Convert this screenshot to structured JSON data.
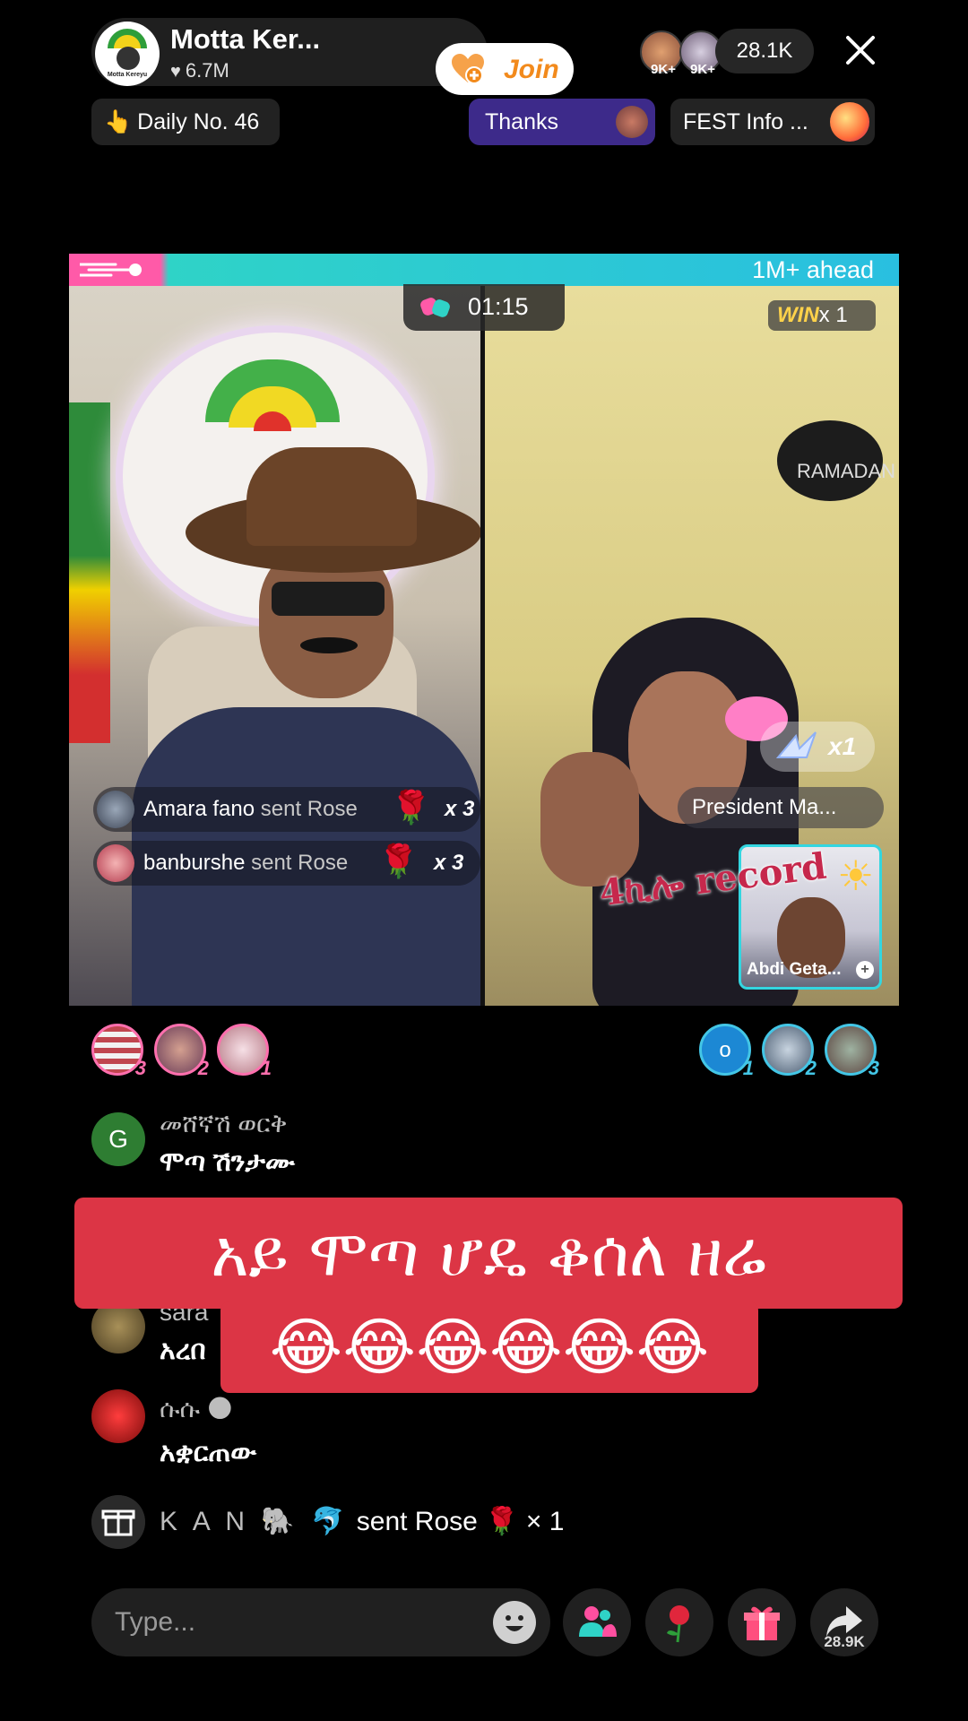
{
  "host": {
    "name": "Motta Ker...",
    "likes": "6.7M",
    "logo_text": "Motta Kereyu",
    "join_label": "Join"
  },
  "viewers": {
    "badge_1": "9K+",
    "badge_2": "9K+",
    "count": "28.1K"
  },
  "chips": {
    "daily": "Daily No. 46",
    "thanks": "Thanks",
    "fest": "FEST Info ..."
  },
  "battle": {
    "ahead_text": "1M+ ahead",
    "timer": "01:15",
    "win_label": "WIN",
    "win_count": "x 1",
    "crane_count": "x1",
    "guest_name": "President Ma...",
    "cohost_name": "Abdi Geta...",
    "overlay_caption": "4ኪሎ record",
    "ramadan_text": "RAMADAN"
  },
  "gifts_left": [
    {
      "user": "Amara fano",
      "action": " sent Rose",
      "count": "x 3"
    },
    {
      "user": "banburshe",
      "action": " sent Rose",
      "count": "x 3"
    }
  ],
  "rank_left": [
    {
      "num": "3"
    },
    {
      "num": "2"
    },
    {
      "num": "1"
    }
  ],
  "rank_right": [
    {
      "letter": "o",
      "num": "1"
    },
    {
      "num": "2"
    },
    {
      "num": "3"
    }
  ],
  "chat": [
    {
      "avatar_letter": "G",
      "user": "መሸኛሽ ወርቅ",
      "message": "ሞጣ ሽንታሙ"
    },
    {
      "user": "sara",
      "message": "አረበ"
    },
    {
      "user": "ሱሱ 🌑",
      "message": "አቋርጠው"
    }
  ],
  "banner": {
    "line1": "አይ ሞጣ ሆዴ ቆሰለ ዘሬ",
    "line2": "😂😂😂😂😂😂"
  },
  "gift_line": {
    "user": "K A N 🐘 🐬",
    "action": " sent Rose ",
    "rose": "🌹",
    "count": " × 1"
  },
  "bottom": {
    "placeholder": "Type...",
    "share_count": "28.9K"
  },
  "colors": {
    "accent_teal": "#2fd3c7",
    "accent_pink": "#ff5aa8",
    "banner_red": "#dc3545",
    "join_orange": "#f28a1c"
  }
}
